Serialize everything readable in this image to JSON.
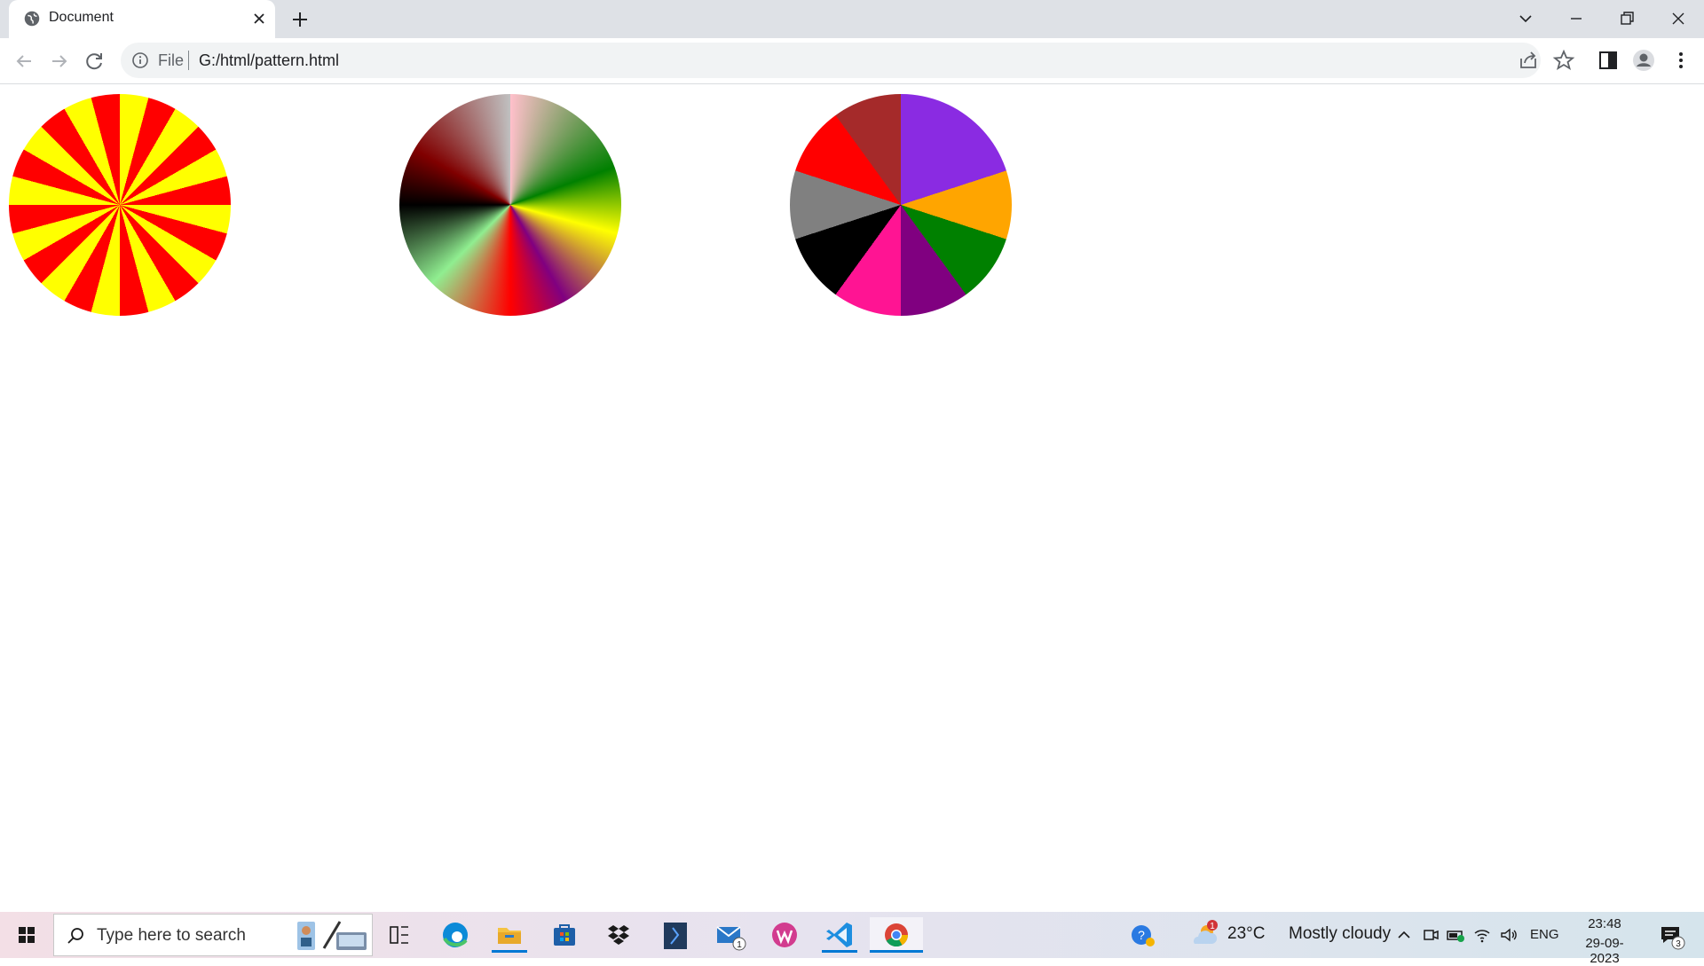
{
  "browser": {
    "tab_title": "Document",
    "omnibox": {
      "scheme_label": "File",
      "url": "G:/html/pattern.html"
    }
  },
  "page": {
    "pies": [
      {
        "name": "yellow-red-striped-pie",
        "colors": [
          "#ffff00",
          "#ff0000"
        ]
      },
      {
        "name": "gradient-pie",
        "colors": [
          "pink",
          "#008000",
          "#ffff00",
          "#800080",
          "#ff0000",
          "#90ee90",
          "#000000",
          "#800000",
          "#c0c0c0"
        ]
      },
      {
        "name": "multicolor-segment-pie",
        "colors": [
          "#8a2be2",
          "#ffa500",
          "#008000",
          "#800080",
          "#ff1493",
          "#000000",
          "#808080",
          "#ff0000",
          "#a52a2a"
        ]
      }
    ]
  },
  "taskbar": {
    "search_placeholder": "Type here to search",
    "mail_badge": "1",
    "weather": {
      "temp": "23°C",
      "condition": "Mostly cloudy",
      "badge": "1"
    },
    "language": "ENG",
    "time": "23:48",
    "date": "29-09-2023",
    "notification_count": "3",
    "apps": [
      "task-view",
      "edge",
      "file-explorer",
      "microsoft-store",
      "dropbox",
      "powershell",
      "mail",
      "wps-office",
      "vscode",
      "chrome"
    ]
  }
}
